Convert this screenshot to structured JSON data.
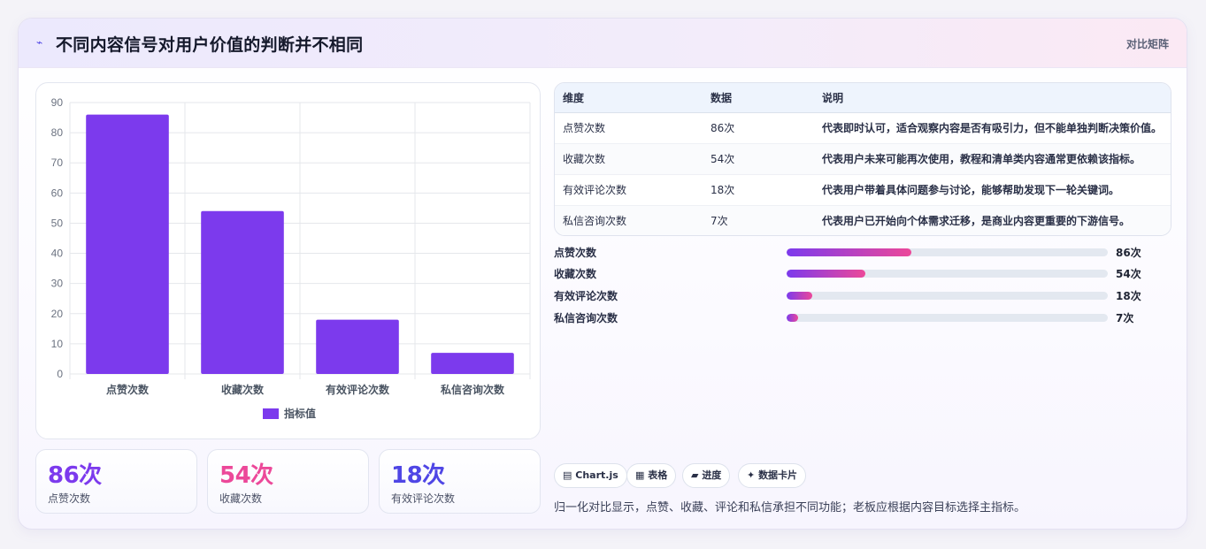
{
  "header": {
    "icon": "sparkle-icon",
    "title": "不同内容信号对用户价值的判断并不相同",
    "tag": "对比矩阵"
  },
  "chart_data": {
    "type": "bar",
    "categories": [
      "点赞次数",
      "收藏次数",
      "有效评论次数",
      "私信咨询次数"
    ],
    "series": [
      {
        "name": "指标值",
        "values": [
          86,
          54,
          18,
          7
        ],
        "color": "#7c3aed"
      }
    ],
    "ylim": [
      0,
      90
    ],
    "yticks": [
      0,
      10,
      20,
      30,
      40,
      50,
      60,
      70,
      80,
      90
    ],
    "grid": true,
    "legend_position": "bottom"
  },
  "stats": [
    {
      "value": "86次",
      "label": "点赞次数",
      "color": "#7c3aed"
    },
    {
      "value": "54次",
      "label": "收藏次数",
      "color": "#ec4899"
    },
    {
      "value": "18次",
      "label": "有效评论次数",
      "color": "#4f46e5"
    }
  ],
  "table": {
    "headers": [
      "维度",
      "数据",
      "说明"
    ],
    "rows": [
      [
        "点赞次数",
        "86次",
        "代表即时认可，适合观察内容是否有吸引力，但不能单独判断决策价值。"
      ],
      [
        "收藏次数",
        "54次",
        "代表用户未来可能再次使用，教程和清单类内容通常更依赖该指标。"
      ],
      [
        "有效评论次数",
        "18次",
        "代表用户带着具体问题参与讨论，能够帮助发现下一轮关键词。"
      ],
      [
        "私信咨询次数",
        "7次",
        "代表用户已开始向个体需求迁移，是商业内容更重要的下游信号。"
      ]
    ]
  },
  "progress": [
    {
      "label": "点赞次数",
      "value": "86次",
      "fraction": 0.3875
    },
    {
      "label": "收藏次数",
      "value": "54次",
      "fraction": 0.245
    },
    {
      "label": "有效评论次数",
      "value": "18次",
      "fraction": 0.08
    },
    {
      "label": "私信咨询次数",
      "value": "7次",
      "fraction": 0.035
    }
  ],
  "chips": [
    {
      "icon": "chart-icon",
      "glyph": "▤",
      "label": "Chart.js"
    },
    {
      "icon": "table-icon",
      "glyph": "▦",
      "label": "表格"
    },
    {
      "icon": "progress-icon",
      "glyph": "▰",
      "label": "进度"
    },
    {
      "icon": "card-icon",
      "glyph": "✦",
      "label": "数据卡片"
    }
  ],
  "note": "归一化对比显示，点赞、收藏、评论和私信承担不同功能；老板应根据内容目标选择主指标。"
}
